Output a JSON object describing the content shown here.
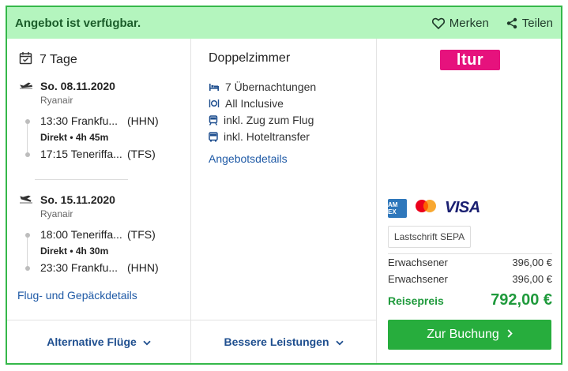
{
  "header": {
    "availability": "Angebot ist verfügbar.",
    "save_label": "Merken",
    "share_label": "Teilen"
  },
  "trip": {
    "duration": "7 Tage",
    "outbound": {
      "date": "So. 08.11.2020",
      "airline": "Ryanair",
      "departure": {
        "time_city": "13:30 Frankfu...",
        "code": "(HHN)"
      },
      "info": "Direkt  •  4h 45m",
      "arrival": {
        "time_city": "17:15 Teneriffa...",
        "code": "(TFS)"
      }
    },
    "return": {
      "date": "So. 15.11.2020",
      "airline": "Ryanair",
      "departure": {
        "time_city": "18:00 Teneriffa...",
        "code": "(TFS)"
      },
      "info": "Direkt  •  4h 30m",
      "arrival": {
        "time_city": "23:30 Frankfu...",
        "code": "(HHN)"
      }
    },
    "flight_details_link": "Flug- und Gepäckdetails"
  },
  "hotel": {
    "room": "Doppelzimmer",
    "features": [
      {
        "icon": "bed-icon",
        "label": "7 Übernachtungen"
      },
      {
        "icon": "cutlery-icon",
        "label": "All Inclusive"
      },
      {
        "icon": "train-icon",
        "label": "inkl. Zug zum Flug"
      },
      {
        "icon": "bus-icon",
        "label": "inkl. Hoteltransfer"
      }
    ],
    "details_link": "Angebotsdetails"
  },
  "pricing": {
    "brand": "ltur",
    "payment_methods": [
      "American Express",
      "Mastercard",
      "VISA"
    ],
    "amex_text": "AM EX",
    "visa_text": "VISA",
    "sepa_label": "Lastschrift SEPA",
    "rows": [
      {
        "label": "Erwachsener",
        "value": "396,00 €"
      },
      {
        "label": "Erwachsener",
        "value": "396,00 €"
      }
    ],
    "total_label": "Reisepreis",
    "total_value": "792,00 €",
    "book_label": "Zur Buchung"
  },
  "footer": {
    "alt_flights": "Alternative Flüge",
    "better_services": "Bessere Leistungen"
  },
  "colors": {
    "accent_green": "#27ad3d",
    "header_bg": "#b4f5be",
    "link_blue": "#1f5aa6",
    "brand_pink": "#e6127d"
  }
}
